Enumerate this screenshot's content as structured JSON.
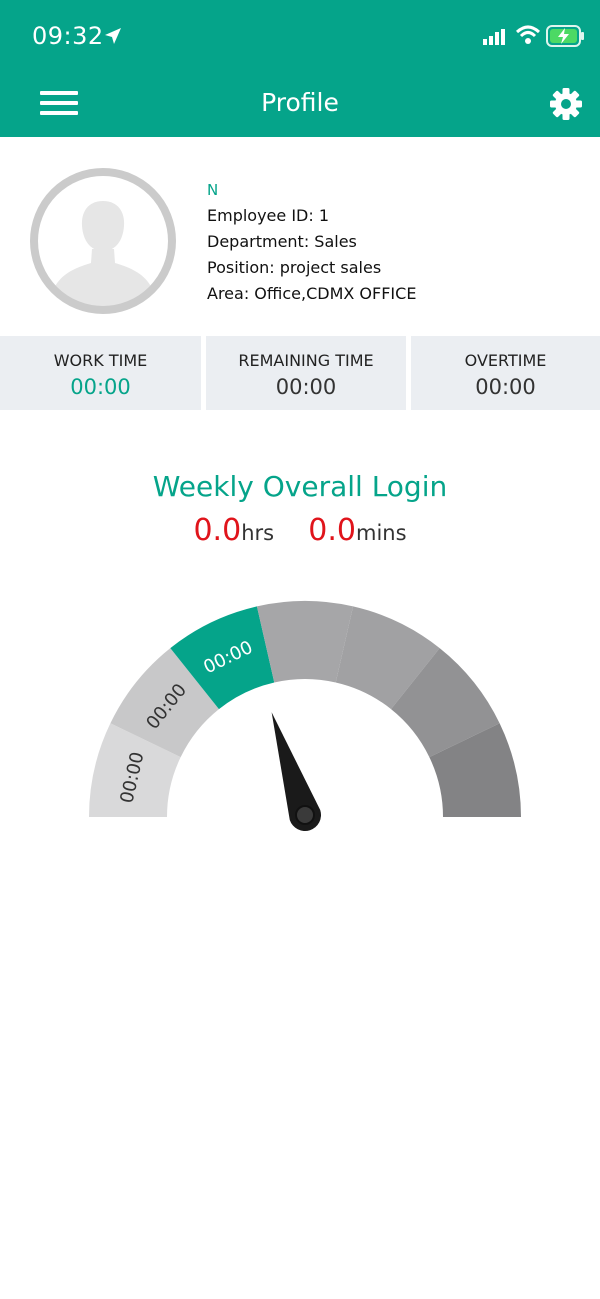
{
  "status_bar": {
    "time": "09:32",
    "icons": [
      "location-arrow-icon",
      "signal-icon",
      "wifi-icon",
      "battery-charging-icon"
    ]
  },
  "header": {
    "title": "Profile",
    "menu_icon": "hamburger-menu-icon",
    "settings_icon": "gear-icon"
  },
  "profile": {
    "avatar_icon": "user-silhouette-icon",
    "name": "N",
    "employee_id": "Employee ID: 1",
    "department": "Department: Sales",
    "position": "Position: project sales",
    "area": "Area: Office,CDMX OFFICE"
  },
  "stats": [
    {
      "label": "WORK TIME",
      "value": "00:00"
    },
    {
      "label": "REMAINING TIME",
      "value": "00:00"
    },
    {
      "label": "OVERTIME",
      "value": "00:00"
    }
  ],
  "weekly": {
    "title": "Weekly Overall Login",
    "hours": "0.0",
    "hours_unit": "hrs",
    "minutes": "0.0",
    "minutes_unit": "mins"
  },
  "gauge": {
    "segments": [
      {
        "label": "00:00",
        "color": "#d9d9da"
      },
      {
        "label": "00:00",
        "color": "#c8c8c9"
      },
      {
        "label": "00:00",
        "color": "#05a48a"
      },
      {
        "label": "",
        "color": "#a6a6a8"
      },
      {
        "label": "",
        "color": "#a1a1a3"
      },
      {
        "label": "",
        "color": "#929294"
      },
      {
        "label": "",
        "color": "#838385"
      }
    ],
    "needle_value_fraction": 0.4,
    "accent_color": "#05a48a"
  },
  "colors": {
    "primary": "#05a48a",
    "alert": "#e0141b",
    "stat_bg": "#ebeef2"
  }
}
